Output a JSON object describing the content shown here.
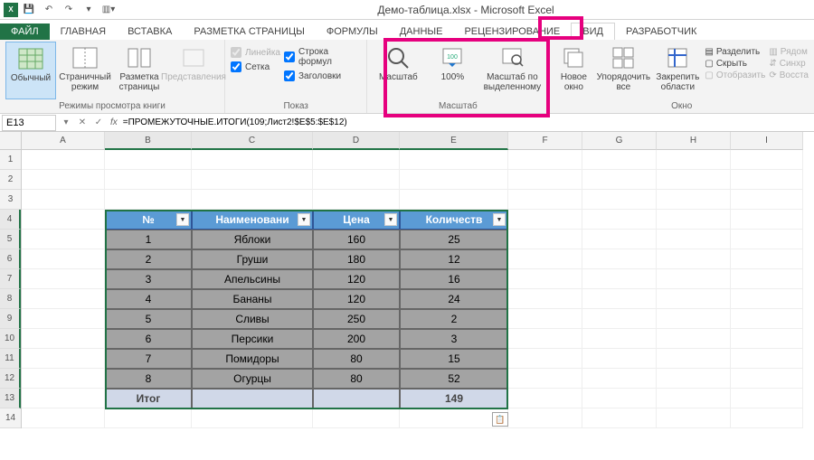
{
  "title": "Демо-таблица.xlsx - Microsoft Excel",
  "qat": {
    "save": "💾",
    "undo": "↶",
    "redo": "↷"
  },
  "tabs": {
    "file": "ФАЙЛ",
    "home": "ГЛАВНАЯ",
    "insert": "ВСТАВКА",
    "layout": "РАЗМЕТКА СТРАНИЦЫ",
    "formulas": "ФОРМУЛЫ",
    "data": "ДАННЫЕ",
    "review": "РЕЦЕНЗИРОВАНИЕ",
    "view": "ВИД",
    "dev": "РАЗРАБОТЧИК"
  },
  "ribbon": {
    "views": {
      "normal": "Обычный",
      "page": "Страничный режим",
      "pagelayout": "Разметка страницы",
      "custom": "Представления",
      "group": "Режимы просмотра книги"
    },
    "show": {
      "ruler": "Линейка",
      "formula": "Строка формул",
      "grid": "Сетка",
      "headings": "Заголовки",
      "group": "Показ"
    },
    "zoom": {
      "zoom": "Масштаб",
      "hundred": "100%",
      "tosel": "Масштаб по выделенному",
      "group": "Масштаб"
    },
    "window": {
      "neww": "Новое окно",
      "arrange": "Упорядочить все",
      "freeze": "Закрепить области",
      "split": "Разделить",
      "hide": "Скрыть",
      "unhide": "Отобразить",
      "side": "Рядом",
      "sync": "Синхр",
      "restore": "Восста",
      "group": "Окно"
    }
  },
  "fbar": {
    "name": "E13",
    "formula": "=ПРОМЕЖУТОЧНЫЕ.ИТОГИ(109;Лист2!$E$5:$E$12)"
  },
  "cols": [
    "A",
    "B",
    "C",
    "D",
    "E",
    "F",
    "G",
    "H",
    "I"
  ],
  "rows": [
    "1",
    "2",
    "3",
    "4",
    "5",
    "6",
    "7",
    "8",
    "9",
    "10",
    "11",
    "12",
    "13",
    "14"
  ],
  "table": {
    "headers": {
      "b": "№",
      "c": "Наименовани",
      "d": "Цена",
      "e": "Количеств"
    },
    "data": [
      {
        "b": "1",
        "c": "Яблоки",
        "d": "160",
        "e": "25"
      },
      {
        "b": "2",
        "c": "Груши",
        "d": "180",
        "e": "12"
      },
      {
        "b": "3",
        "c": "Апельсины",
        "d": "120",
        "e": "16"
      },
      {
        "b": "4",
        "c": "Бананы",
        "d": "120",
        "e": "24"
      },
      {
        "b": "5",
        "c": "Сливы",
        "d": "250",
        "e": "2"
      },
      {
        "b": "6",
        "c": "Персики",
        "d": "200",
        "e": "3"
      },
      {
        "b": "7",
        "c": "Помидоры",
        "d": "80",
        "e": "15"
      },
      {
        "b": "8",
        "c": "Огурцы",
        "d": "80",
        "e": "52"
      }
    ],
    "total": {
      "b": "Итог",
      "e": "149"
    }
  }
}
